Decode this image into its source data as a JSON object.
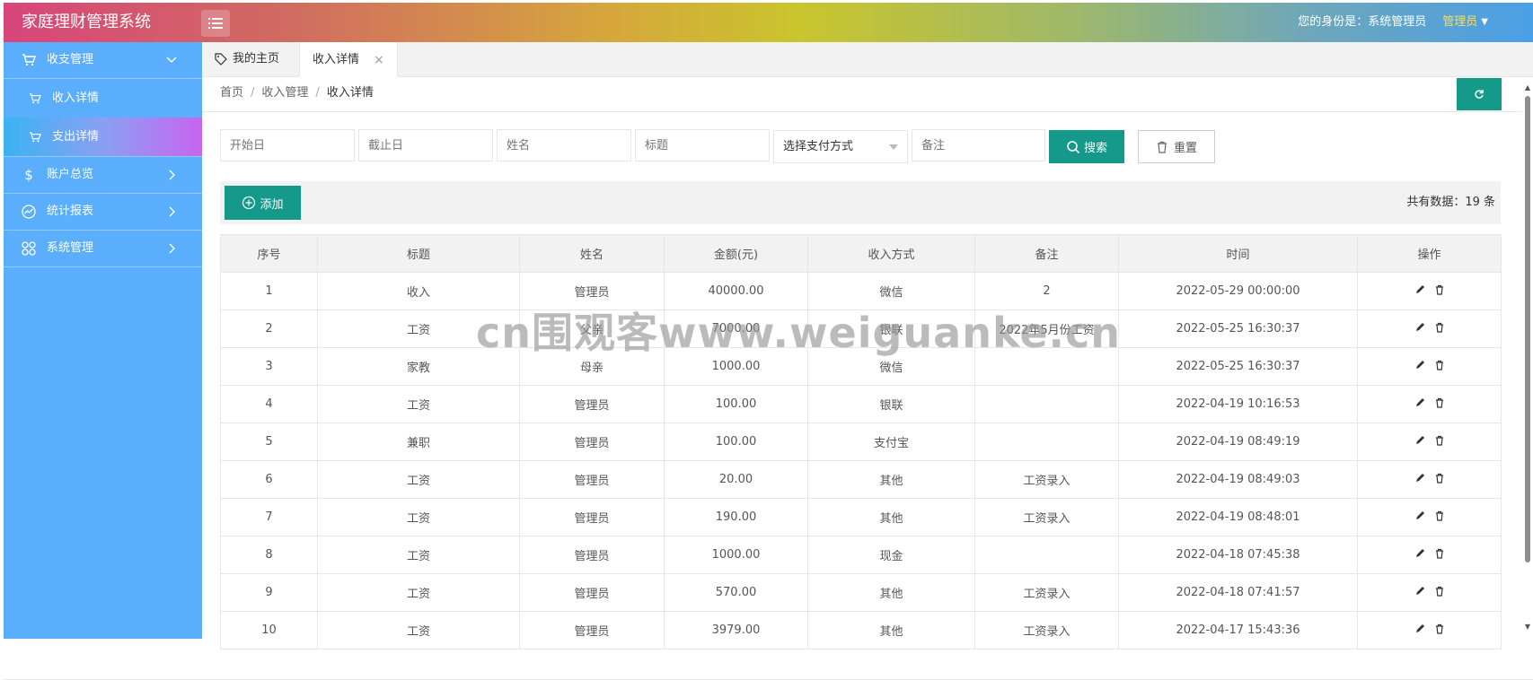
{
  "app": {
    "title": "家庭理财管理系统"
  },
  "header": {
    "identity_label": "您的身份是：系统管理员",
    "user_menu": "管理员"
  },
  "sidebar": {
    "groups": [
      {
        "label": "收支管理",
        "icon": "cart-icon",
        "expanded": true,
        "children": [
          {
            "label": "收入详情"
          },
          {
            "label": "支出详情",
            "active": true
          }
        ]
      },
      {
        "label": "账户总览",
        "icon": "dollar-icon"
      },
      {
        "label": "统计报表",
        "icon": "chart-icon"
      },
      {
        "label": "系统管理",
        "icon": "grid-icon"
      }
    ]
  },
  "tabs": [
    {
      "label": "我的主页",
      "icon": "tag-icon"
    },
    {
      "label": "收入详情",
      "active": true
    }
  ],
  "breadcrumb": [
    "首页",
    "收入管理",
    "收入详情"
  ],
  "search": {
    "start_placeholder": "开始日",
    "end_placeholder": "截止日",
    "name_placeholder": "姓名",
    "title_placeholder": "标题",
    "payment_select": "选择支付方式",
    "note_placeholder": "备注",
    "search_label": "搜索",
    "reset_label": "重置"
  },
  "toolbar": {
    "add_label": "添加",
    "total_text": "共有数据：19 条"
  },
  "table": {
    "headers": [
      "序号",
      "标题",
      "姓名",
      "金额(元)",
      "收入方式",
      "备注",
      "时间",
      "操作"
    ],
    "rows": [
      [
        "1",
        "收入",
        "管理员",
        "40000.00",
        "微信",
        "2",
        "2022-05-29 00:00:00"
      ],
      [
        "2",
        "工资",
        "父亲",
        "7000.00",
        "银联",
        "2022年5月份工资",
        "2022-05-25 16:30:37"
      ],
      [
        "3",
        "家教",
        "母亲",
        "1000.00",
        "微信",
        "",
        "2022-05-25 16:30:37"
      ],
      [
        "4",
        "工资",
        "管理员",
        "100.00",
        "银联",
        "",
        "2022-04-19 10:16:53"
      ],
      [
        "5",
        "兼职",
        "管理员",
        "100.00",
        "支付宝",
        "",
        "2022-04-19 08:49:19"
      ],
      [
        "6",
        "工资",
        "管理员",
        "20.00",
        "其他",
        "工资录入",
        "2022-04-19 08:49:03"
      ],
      [
        "7",
        "工资",
        "管理员",
        "190.00",
        "其他",
        "工资录入",
        "2022-04-19 08:48:01"
      ],
      [
        "8",
        "工资",
        "管理员",
        "1000.00",
        "现金",
        "",
        "2022-04-18 07:45:38"
      ],
      [
        "9",
        "工资",
        "管理员",
        "570.00",
        "其他",
        "工资录入",
        "2022-04-18 07:41:57"
      ],
      [
        "10",
        "工资",
        "管理员",
        "3979.00",
        "其他",
        "工资录入",
        "2022-04-17 15:43:36"
      ]
    ]
  },
  "watermark": "cn围观客www.weiguanke.cn",
  "colors": {
    "primary": "#14998a",
    "sidebar": "#5aaefb",
    "accent_user": "#ffde59"
  }
}
